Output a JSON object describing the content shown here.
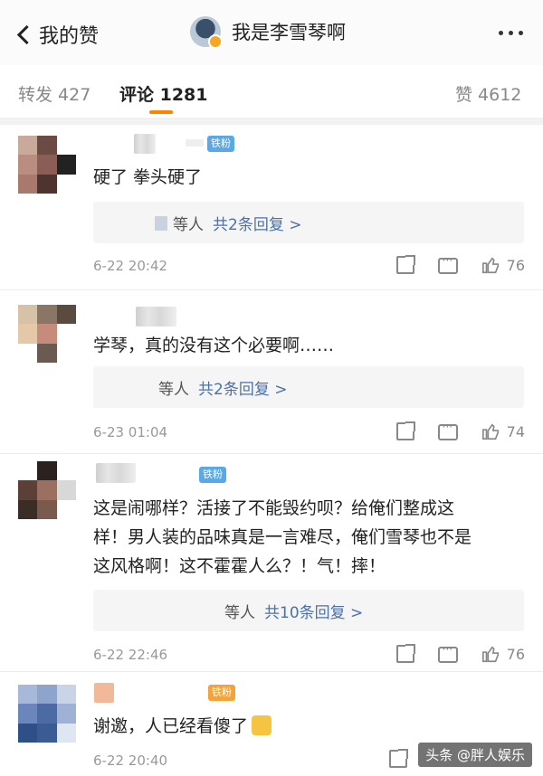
{
  "header": {
    "back_label": "我的赞",
    "title": "我是李雪琴啊"
  },
  "tabs": [
    {
      "label": "转发 427"
    },
    {
      "label": "评论 1281"
    },
    {
      "label": "赞 4612"
    }
  ],
  "badges": {
    "iron_fan": "铁粉"
  },
  "comments": [
    {
      "text": "硬了 拳头硬了",
      "reply_prefix": "等人",
      "reply_count": "共2条回复 >",
      "time": "6-22 20:42",
      "likes": "76"
    },
    {
      "text": "学琴，真的没有这个必要啊……",
      "reply_prefix": "等人",
      "reply_count": "共2条回复 >",
      "time": "6-23 01:04",
      "likes": "74"
    },
    {
      "text_lines": [
        "这是闹哪样？活接了不能毁约呗？给俺们整成这",
        "样！男人装的品味真是一言难尽，俺们雪琴也不是",
        "这风格啊！这不霍霍人么？！气！摔！"
      ],
      "reply_prefix": "等人",
      "reply_count": "共10条回复 >",
      "time": "6-22 22:46",
      "likes": "76"
    },
    {
      "text": "谢邀，人已经看傻了",
      "time": "6-22 20:40"
    }
  ],
  "icons": {
    "share": "share-icon",
    "comment": "comment-icon",
    "like": "thumbs-up-icon"
  },
  "watermark": "头条 @胖人娱乐",
  "colors": {
    "accent": "#ff8200",
    "link": "#4b72a8",
    "badge": "#5aa9e6"
  }
}
